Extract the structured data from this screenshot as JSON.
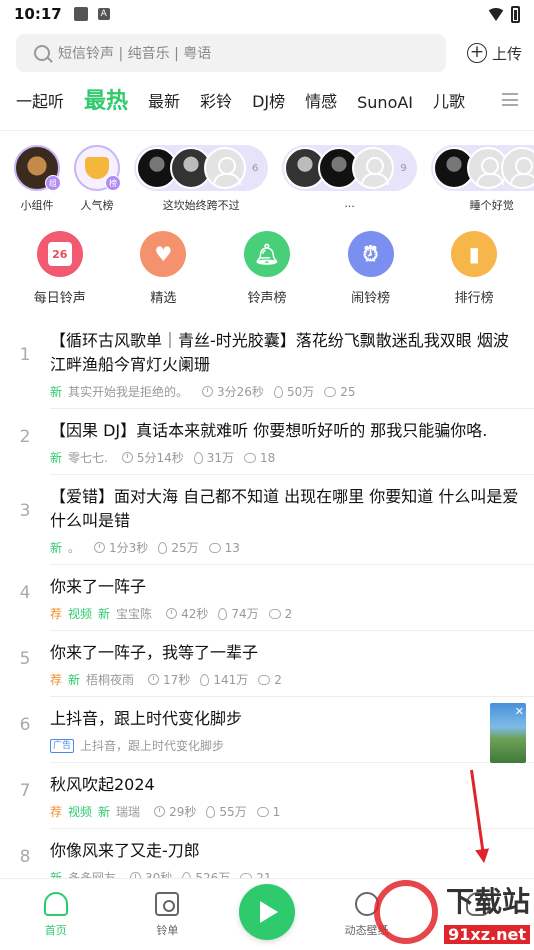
{
  "status_bar": {
    "time": "10:17",
    "icon_a": "A"
  },
  "search": {
    "placeholder": "短信铃声 | 纯音乐 | 粤语",
    "upload_label": "上传"
  },
  "tabs": [
    {
      "label": "一起听"
    },
    {
      "label": "最热",
      "active": true
    },
    {
      "label": "最新"
    },
    {
      "label": "彩铃"
    },
    {
      "label": "DJ榜"
    },
    {
      "label": "情感"
    },
    {
      "label": "SunoAI"
    },
    {
      "label": "儿歌"
    }
  ],
  "stories": {
    "widget": {
      "caption": "小组件",
      "badge": "组"
    },
    "popular": {
      "caption": "人气榜",
      "badge": "榜"
    },
    "group1": {
      "caption": "这坎始终跨不过",
      "count": "6"
    },
    "group2": {
      "caption": "...",
      "count": "9"
    },
    "group3": {
      "caption": "睡个好觉"
    }
  },
  "quick_entries": [
    {
      "label": "每日铃声",
      "icon": "calendar-icon",
      "icon_text": "26",
      "color": "#f25a72"
    },
    {
      "label": "精选",
      "icon": "heart-box-icon",
      "color": "#f4926d"
    },
    {
      "label": "铃声榜",
      "icon": "bell-icon",
      "color": "#49cf7a"
    },
    {
      "label": "闹铃榜",
      "icon": "alarm-clock-icon",
      "color": "#7b8ff0"
    },
    {
      "label": "排行榜",
      "icon": "bar-chart-icon",
      "color": "#f7b64a"
    }
  ],
  "songs": [
    {
      "rank": "1",
      "title": "【循环古风歌单｜青丝-时光胶囊】落花纷飞飘散迷乱我双眼 烟波江畔渔船今宵灯火阑珊",
      "tags": [
        "新"
      ],
      "author": "其实开始我是拒绝的。",
      "duration": "3分26秒",
      "plays": "50万",
      "comments": "25"
    },
    {
      "rank": "2",
      "title": "【因果 DJ】真话本来就难听 你要想听好听的 那我只能骗你咯.",
      "tags": [
        "新"
      ],
      "author": "零七七.",
      "duration": "5分14秒",
      "plays": "31万",
      "comments": "18"
    },
    {
      "rank": "3",
      "title": "【爱错】面对大海 自己都不知道 出现在哪里 你要知道 什么叫是爱 什么叫是错",
      "tags": [
        "新"
      ],
      "author": "。",
      "duration": "1分3秒",
      "plays": "25万",
      "comments": "13"
    },
    {
      "rank": "4",
      "title": "你来了一阵子",
      "tags": [
        "荐",
        "视频",
        "新"
      ],
      "author": "宝宝陈",
      "duration": "42秒",
      "plays": "74万",
      "comments": "2"
    },
    {
      "rank": "5",
      "title": "你来了一阵子，我等了一辈子",
      "tags": [
        "荐",
        "新"
      ],
      "author": "梧桐夜雨",
      "duration": "17秒",
      "plays": "141万",
      "comments": "2"
    },
    {
      "rank": "6",
      "title": "上抖音，跟上时代变化脚步",
      "ad": true,
      "ad_label": "广告",
      "ad_text": "上抖音，跟上时代变化脚步"
    },
    {
      "rank": "7",
      "title": "秋风吹起2024",
      "tags": [
        "荐",
        "视频",
        "新"
      ],
      "author": "瑞瑞",
      "duration": "29秒",
      "plays": "55万",
      "comments": "1"
    },
    {
      "rank": "8",
      "title": "你像风来了又走-刀郎",
      "tags": [
        "新"
      ],
      "author": "多多网友",
      "duration": "30秒",
      "plays": "526万",
      "comments": "21"
    }
  ],
  "bottom_nav": {
    "home": "首页",
    "playlist": "铃单",
    "dynamic": "动态壁纸",
    "mine": "我的"
  },
  "watermark": {
    "main": "下载站",
    "sub": "91xz.net"
  }
}
